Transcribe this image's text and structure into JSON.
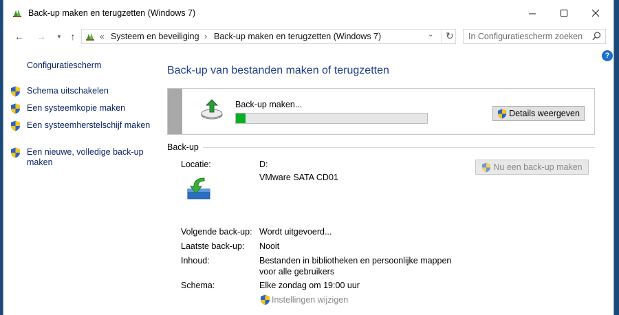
{
  "window": {
    "title": "Back-up maken en terugzetten (Windows 7)"
  },
  "address": {
    "crumbs": [
      "Systeem en beveiliging",
      "Back-up maken en terugzetten (Windows 7)"
    ],
    "overflow": "«",
    "separator": "›"
  },
  "search": {
    "placeholder": "In Configuratiescherm zoeken"
  },
  "sidebar": {
    "home": "Configuratiescherm",
    "tasks": [
      {
        "label": "Schema uitschakelen"
      },
      {
        "label": "Een systeemkopie maken"
      },
      {
        "label": "Een systeemherstelschijf maken"
      },
      {
        "label": "Een nieuwe, volledige back-up maken"
      }
    ]
  },
  "main": {
    "title": "Back-up van bestanden maken of terugzetten",
    "progress": {
      "label": "Back-up maken...",
      "percent": 5,
      "details_button": "Details weergeven"
    },
    "backup": {
      "header": "Back-up",
      "location_label": "Locatie:",
      "location_drive": "D:",
      "location_name": "VMware SATA CD01",
      "backup_now_button": "Nu een back-up maken",
      "next_label": "Volgende back-up:",
      "next_value": "Wordt uitgevoerd...",
      "last_label": "Laatste back-up:",
      "last_value": "Nooit",
      "contents_label": "Inhoud:",
      "contents_line1": "Bestanden in bibliotheken en persoonlijke mappen",
      "contents_line2": "voor alle gebruikers",
      "schedule_label": "Schema:",
      "schedule_value": "Elke zondag om 19:00 uur",
      "change_settings": "Instellingen wijzigen"
    }
  },
  "colors": {
    "link": "#0a246a",
    "title": "#1e3d8f",
    "progress": "#06b025"
  }
}
